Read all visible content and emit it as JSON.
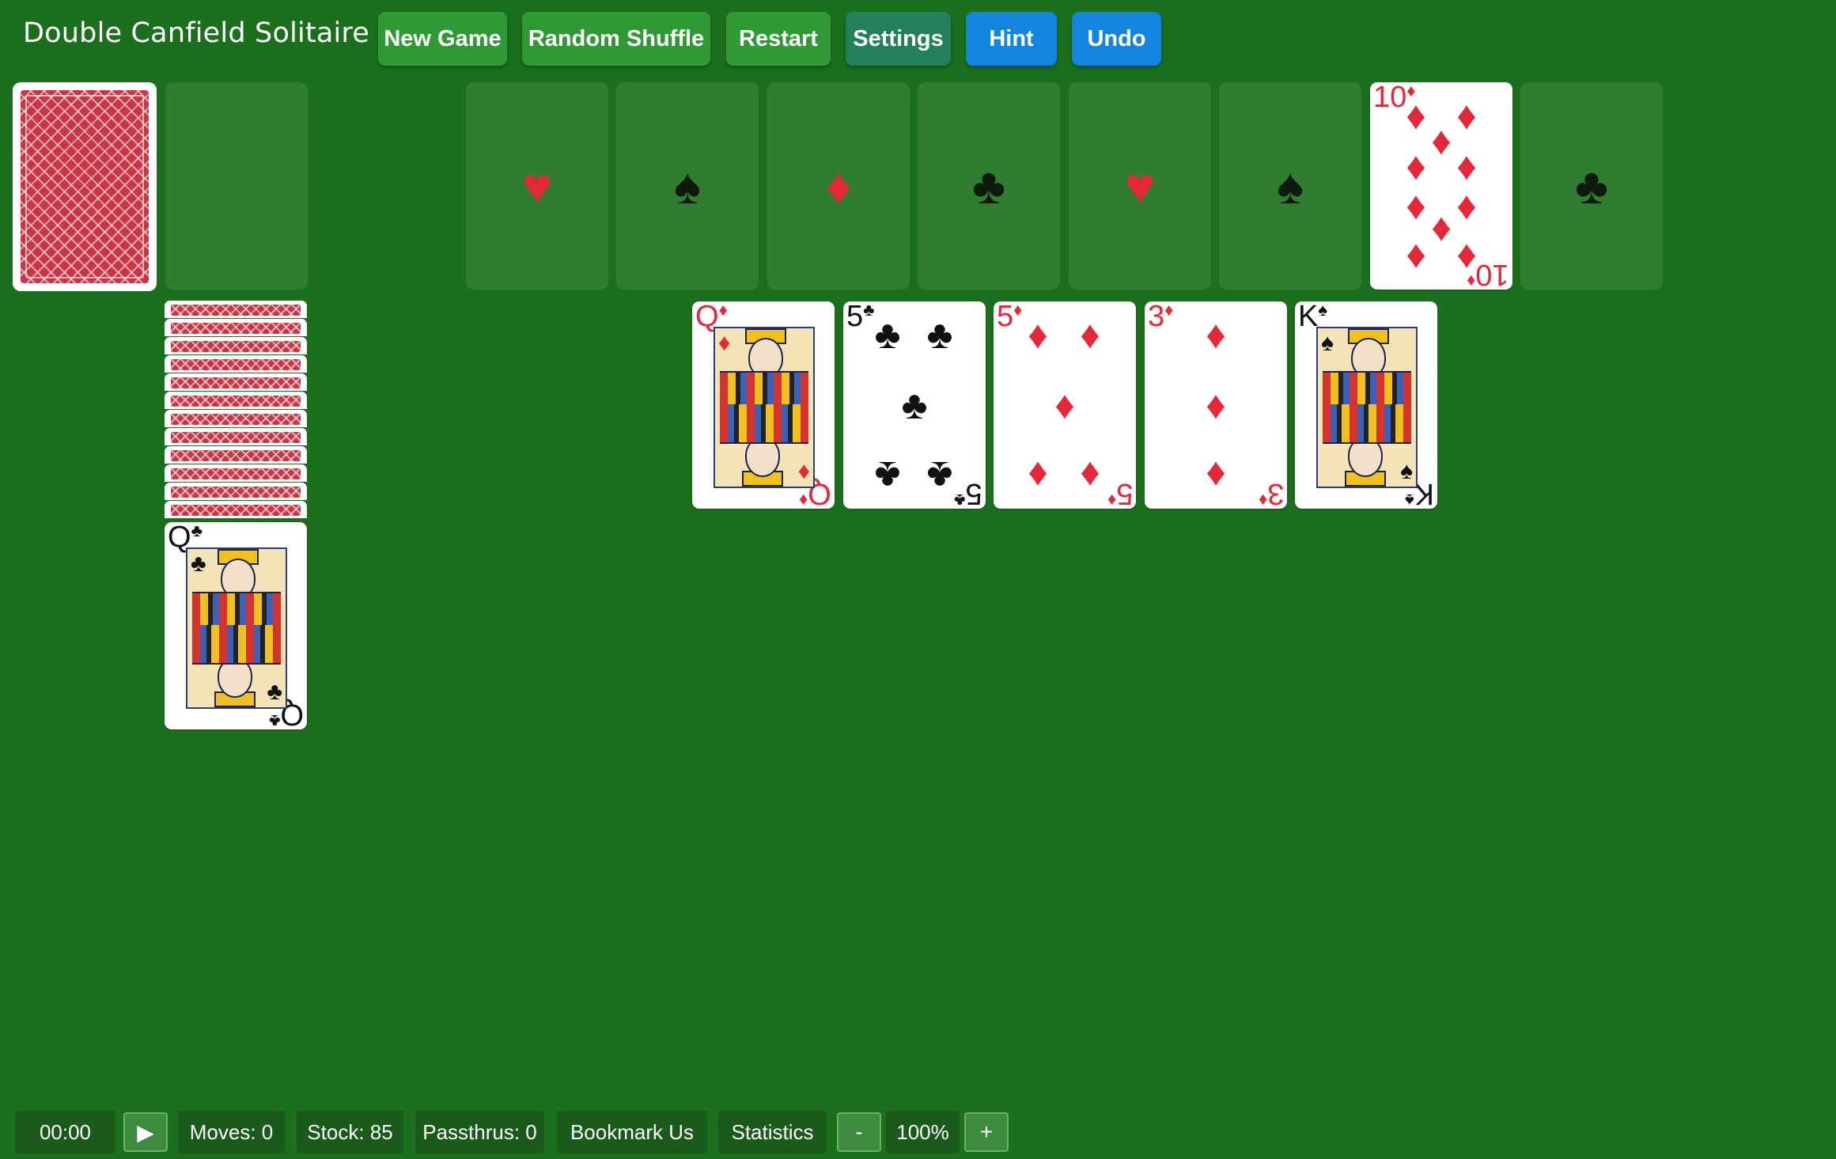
{
  "header": {
    "title": "Double Canfield Solitaire",
    "buttons": {
      "new_game": "New Game",
      "random_shuffle": "Random Shuffle",
      "restart": "Restart",
      "settings": "Settings",
      "hint": "Hint",
      "undo": "Undo"
    }
  },
  "foundations": [
    {
      "suit": "♥",
      "color": "red"
    },
    {
      "suit": "♠",
      "color": "black"
    },
    {
      "suit": "♦",
      "color": "red"
    },
    {
      "suit": "♣",
      "color": "black"
    },
    {
      "suit": "♥",
      "color": "red"
    },
    {
      "suit": "♠",
      "color": "black"
    },
    {
      "card": {
        "rank": "10",
        "suit": "♦",
        "color": "red"
      }
    },
    {
      "suit": "♣",
      "color": "black"
    }
  ],
  "reserve": {
    "hidden_cards": 12,
    "top_card": {
      "rank": "Q",
      "suit": "♣",
      "color": "black"
    }
  },
  "tableau": [
    {
      "rank": "Q",
      "suit": "♦",
      "color": "red"
    },
    {
      "rank": "5",
      "suit": "♣",
      "color": "black"
    },
    {
      "rank": "5",
      "suit": "♦",
      "color": "red"
    },
    {
      "rank": "3",
      "suit": "♦",
      "color": "red"
    },
    {
      "rank": "K",
      "suit": "♠",
      "color": "black"
    }
  ],
  "status_bar": {
    "timer": "00:00",
    "play_icon": "▶",
    "moves": "Moves: 0",
    "stock": "Stock: 85",
    "passthrus": "Passthrus: 0",
    "bookmark": "Bookmark Us",
    "statistics": "Statistics",
    "zoom_out": "-",
    "zoom": "100%",
    "zoom_in": "+"
  },
  "colors": {
    "felt": "#1c6f1d",
    "green_button": "#2f9a35",
    "teal_button": "#24805a",
    "blue_button": "#1185e0",
    "card_red": "#e4283a"
  }
}
